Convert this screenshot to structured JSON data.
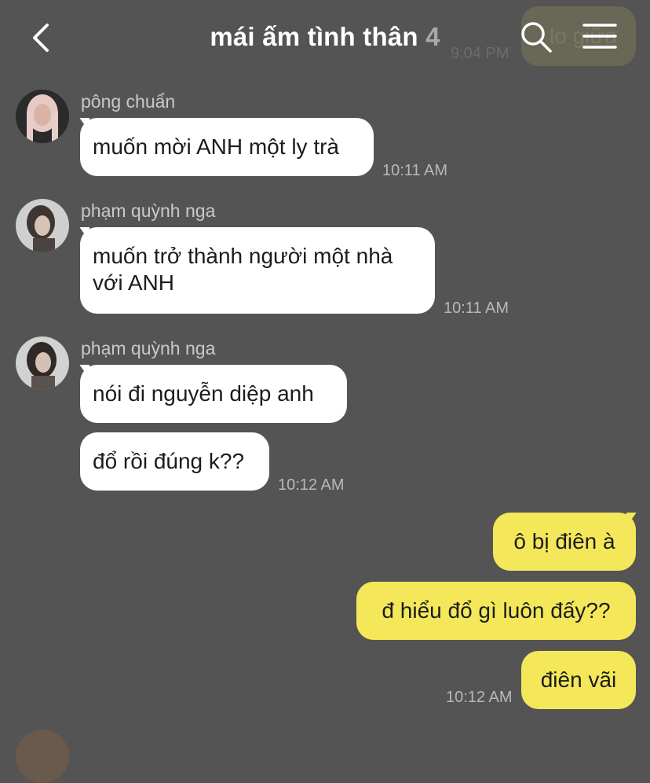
{
  "header": {
    "title": "mái ấm tình thân",
    "member_count": "4",
    "ghost_text": "lo giữa",
    "ghost_time": "9:04 PM"
  },
  "messages": [
    {
      "sender": "pông chuẩn",
      "text": "muốn mời ANH một ly trà",
      "time": "10:11 AM"
    },
    {
      "sender": "phạm quỳnh nga",
      "lines": [
        "muốn trở thành người một nhà",
        "với ANH"
      ],
      "time": "10:11 AM"
    },
    {
      "sender": "phạm quỳnh nga",
      "text": "nói đi nguyễn diệp anh"
    },
    {
      "text": "đổ rồi đúng k??",
      "time": "10:12 AM"
    },
    {
      "text": "ô bị điên à"
    },
    {
      "text": "đ hiểu đổ gì luôn đấy??"
    },
    {
      "text": "điên vãi",
      "time": "10:12 AM"
    }
  ],
  "colors": {
    "background": "#545454",
    "incoming_bubble": "#ffffff",
    "outgoing_bubble": "#f4e85a"
  },
  "icons": [
    "chevron-left-icon",
    "search-icon",
    "menu-icon"
  ]
}
